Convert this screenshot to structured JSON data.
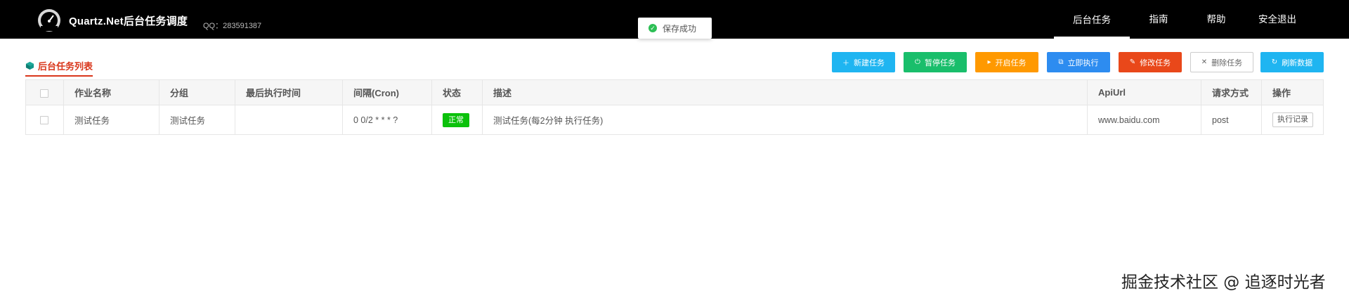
{
  "header": {
    "title": "Quartz.Net后台任务调度",
    "qq": "QQ：283591387",
    "nav": [
      {
        "label": "后台任务",
        "active": true
      },
      {
        "label": "指南",
        "active": false
      },
      {
        "label": "帮助",
        "active": false
      },
      {
        "label": "安全退出",
        "active": false
      }
    ]
  },
  "toast": {
    "message": "保存成功",
    "icon": "check-circle-icon",
    "color": "#2dbf55"
  },
  "panel": {
    "title": "后台任务列表",
    "title_color": "#d9361b"
  },
  "toolbar": {
    "buttons": [
      {
        "label": "新建任务",
        "icon": "plus-icon",
        "color": "#1fb5f1"
      },
      {
        "label": "暂停任务",
        "icon": "power-icon",
        "color": "#19be6b"
      },
      {
        "label": "开启任务",
        "icon": "play-icon",
        "color": "#ff9900"
      },
      {
        "label": "立即执行",
        "icon": "execute-icon",
        "color": "#2d8cf0"
      },
      {
        "label": "修改任务",
        "icon": "wrench-icon",
        "color": "#e9481a"
      },
      {
        "label": "删除任务",
        "icon": "close-icon",
        "color": "#ffffff"
      },
      {
        "label": "刷新数据",
        "icon": "refresh-icon",
        "color": "#1fb5f1"
      }
    ]
  },
  "table": {
    "columns": [
      "作业名称",
      "分组",
      "最后执行时间",
      "间隔(Cron)",
      "状态",
      "描述",
      "ApiUrl",
      "请求方式",
      "操作"
    ],
    "rows": [
      {
        "name": "测试任务",
        "group": "测试任务",
        "last_run": "",
        "cron": "0 0/2 * * * ?",
        "status": "正常",
        "description": "测试任务(每2分钟 执行任务)",
        "api_url": "www.baidu.com",
        "method": "post",
        "action": "执行记录"
      }
    ]
  },
  "watermark": "掘金技术社区 @ 追逐时光者"
}
